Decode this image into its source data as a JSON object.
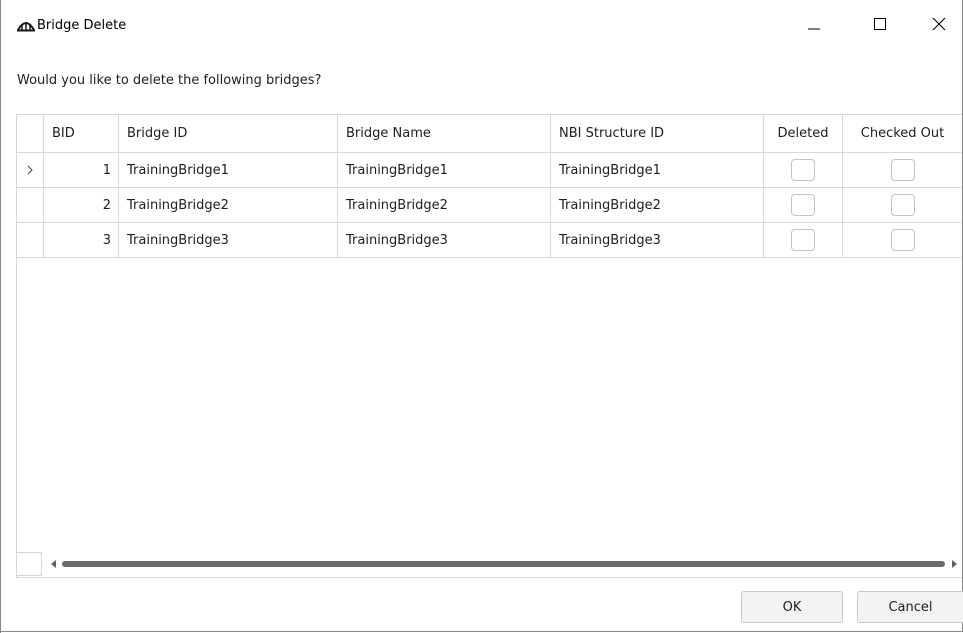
{
  "window": {
    "title": "Bridge Delete",
    "icons": {
      "app": "bridge-icon",
      "minimize": "minimize-icon",
      "maximize": "maximize-icon",
      "close": "close-icon"
    }
  },
  "prompt": "Would you like to delete the following bridges?",
  "grid": {
    "columns": [
      "BID",
      "Bridge ID",
      "Bridge Name",
      "NBI Structure ID",
      "Deleted",
      "Checked Out"
    ],
    "row_selector_icon": "chevron-right-icon",
    "rows": [
      {
        "bid": "1",
        "bridge_id": "TrainingBridge1",
        "bridge_name": "TrainingBridge1",
        "nbi_structure_id": "TrainingBridge1",
        "deleted": false,
        "checked_out": false,
        "current": true
      },
      {
        "bid": "2",
        "bridge_id": "TrainingBridge2",
        "bridge_name": "TrainingBridge2",
        "nbi_structure_id": "TrainingBridge2",
        "deleted": false,
        "checked_out": false,
        "current": false
      },
      {
        "bid": "3",
        "bridge_id": "TrainingBridge3",
        "bridge_name": "TrainingBridge3",
        "nbi_structure_id": "TrainingBridge3",
        "deleted": false,
        "checked_out": false,
        "current": false
      }
    ]
  },
  "buttons": {
    "ok": "OK",
    "cancel": "Cancel"
  }
}
